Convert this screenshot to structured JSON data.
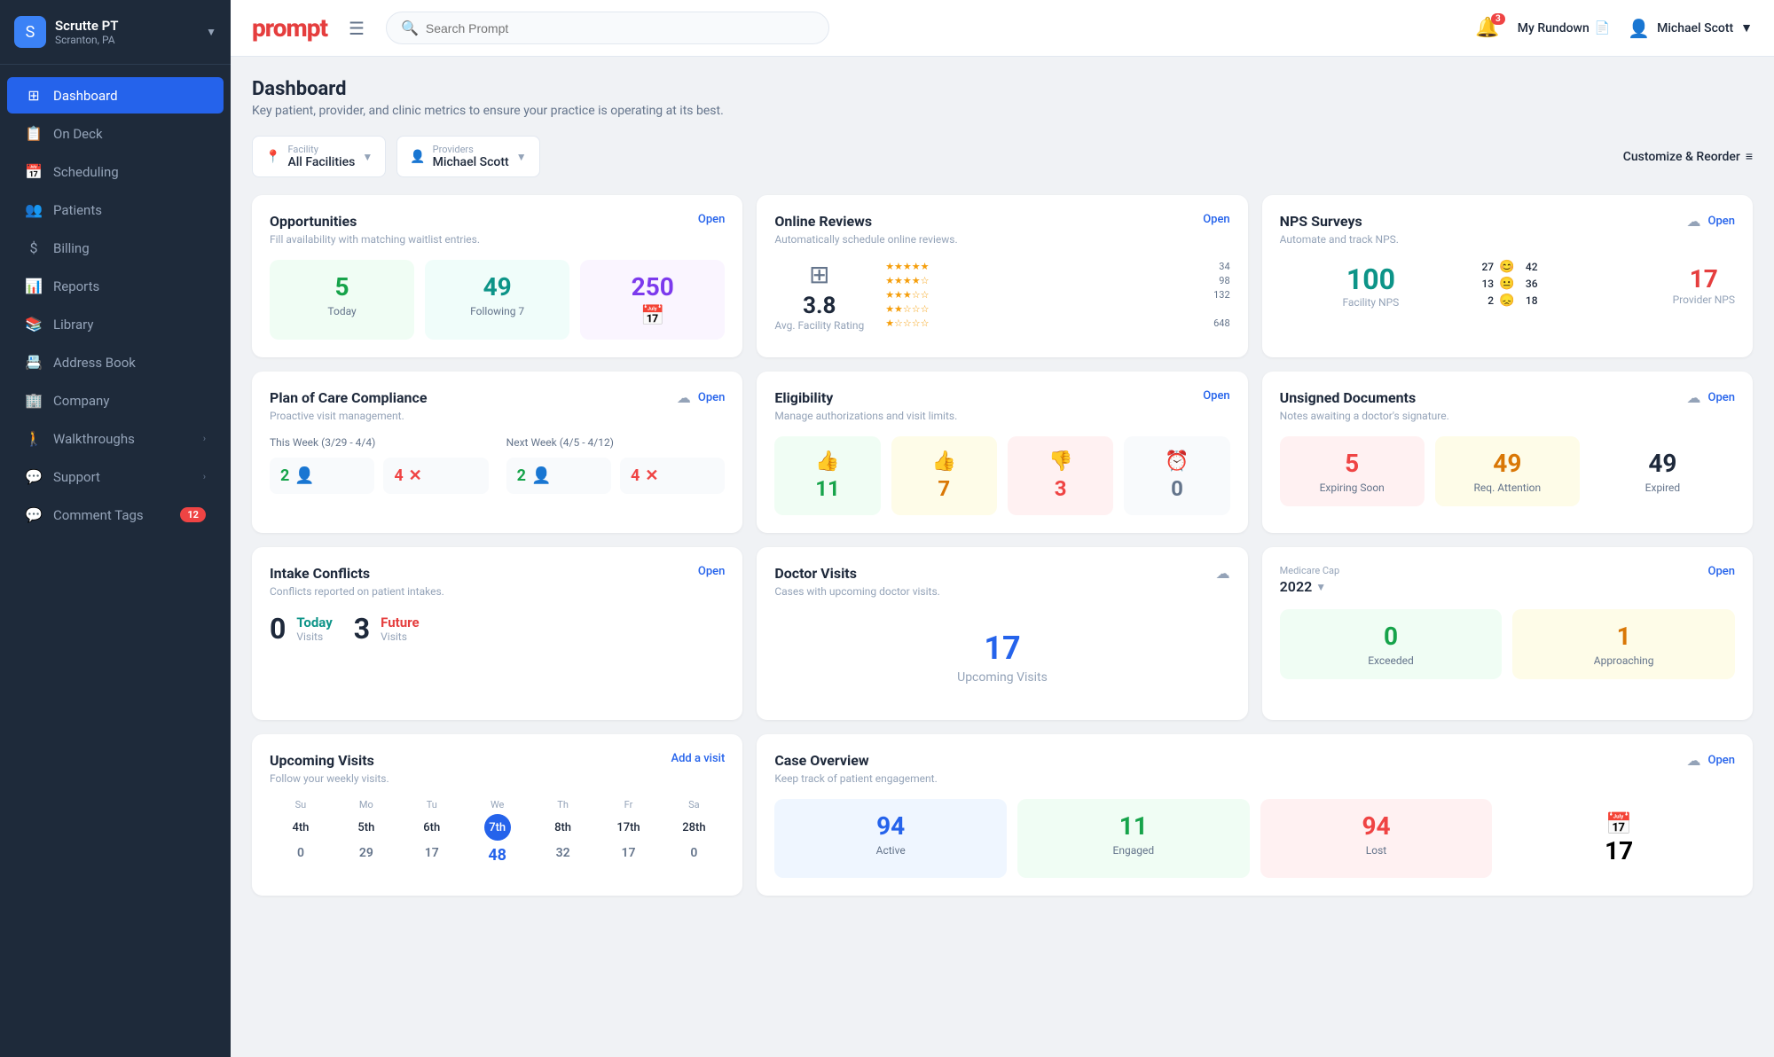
{
  "app": {
    "logo": "prompt",
    "search_placeholder": "Search Prompt"
  },
  "header": {
    "notification_count": "3",
    "my_rundown": "My Rundown",
    "user_name": "Michael Scott"
  },
  "sidebar": {
    "org_name": "Scrutte PT",
    "org_location": "Scranton, PA",
    "items": [
      {
        "id": "dashboard",
        "label": "Dashboard",
        "icon": "⊞",
        "active": true
      },
      {
        "id": "on-deck",
        "label": "On Deck",
        "icon": "📋",
        "active": false
      },
      {
        "id": "scheduling",
        "label": "Scheduling",
        "icon": "📅",
        "active": false
      },
      {
        "id": "patients",
        "label": "Patients",
        "icon": "👥",
        "active": false
      },
      {
        "id": "billing",
        "label": "Billing",
        "icon": "$",
        "active": false
      },
      {
        "id": "reports",
        "label": "Reports",
        "icon": "📊",
        "active": false
      },
      {
        "id": "library",
        "label": "Library",
        "icon": "📚",
        "active": false
      },
      {
        "id": "address-book",
        "label": "Address Book",
        "icon": "📇",
        "active": false
      },
      {
        "id": "company",
        "label": "Company",
        "icon": "🏢",
        "active": false
      },
      {
        "id": "walkthroughs",
        "label": "Walkthroughs",
        "icon": "🚶",
        "active": false,
        "arrow": true
      },
      {
        "id": "support",
        "label": "Support",
        "icon": "💬",
        "active": false,
        "arrow": true
      },
      {
        "id": "comment-tags",
        "label": "Comment Tags",
        "icon": "💬",
        "active": false,
        "badge": "12"
      }
    ]
  },
  "page": {
    "title": "Dashboard",
    "subtitle": "Key patient, provider, and clinic metrics to ensure your practice is operating at its best."
  },
  "filters": {
    "facility_label": "Facility",
    "facility_value": "All Facilities",
    "providers_label": "Providers",
    "providers_value": "Michael Scott",
    "customize_label": "Customize & Reorder"
  },
  "cards": {
    "opportunities": {
      "title": "Opportunities",
      "subtitle": "Fill availability with matching waitlist entries.",
      "open_label": "Open",
      "metrics": [
        {
          "value": "5",
          "label": "Today",
          "color": "green"
        },
        {
          "value": "49",
          "label": "Following 7",
          "color": "teal"
        },
        {
          "value": "250",
          "label": "",
          "color": "purple",
          "icon": "📅"
        }
      ]
    },
    "online_reviews": {
      "title": "Online Reviews",
      "subtitle": "Automatically schedule online reviews.",
      "open_label": "Open",
      "avg_rating": "3.8",
      "avg_label": "Avg. Facility Rating",
      "stars": [
        {
          "stars": 5,
          "count": "34"
        },
        {
          "stars": 4,
          "count": "98"
        },
        {
          "stars": 3,
          "count": "132"
        },
        {
          "stars": 2,
          "count": ""
        },
        {
          "stars": 1,
          "count": "648"
        }
      ]
    },
    "nps_surveys": {
      "title": "NPS Surveys",
      "subtitle": "Automate and track NPS.",
      "open_label": "Open",
      "facility_nps": "100",
      "facility_label": "Facility NPS",
      "rows": [
        {
          "left": "27",
          "face": "happy",
          "right": "42"
        },
        {
          "left": "13",
          "face": "neutral",
          "right": "36"
        },
        {
          "left": "2",
          "face": "sad",
          "right": "18"
        }
      ],
      "provider_nps": "17",
      "provider_label": "Provider NPS"
    },
    "plan_of_care": {
      "title": "Plan of Care Compliance",
      "subtitle": "Proactive visit management.",
      "open_label": "Open",
      "week1_label": "This Week (3/29 - 4/4)",
      "week1_metrics": [
        {
          "value": "2",
          "icon": "👤",
          "color": "green"
        },
        {
          "value": "4",
          "icon": "✕",
          "color": "red"
        }
      ],
      "week2_label": "Next Week (4/5 - 4/12)",
      "week2_metrics": [
        {
          "value": "2",
          "icon": "👤",
          "color": "green"
        },
        {
          "value": "4",
          "icon": "✕",
          "color": "red"
        }
      ]
    },
    "eligibility": {
      "title": "Eligibility",
      "subtitle": "Manage authorizations and visit limits.",
      "open_label": "Open",
      "metrics": [
        {
          "value": "11",
          "icon": "👍",
          "color": "green"
        },
        {
          "value": "7",
          "icon": "👍",
          "color": "yellow"
        },
        {
          "value": "3",
          "icon": "👎",
          "color": "red"
        },
        {
          "value": "0",
          "icon": "⏰",
          "color": "gray"
        }
      ]
    },
    "unsigned_docs": {
      "title": "Unsigned Documents",
      "subtitle": "Notes awaiting a doctor's signature.",
      "open_label": "Open",
      "metrics": [
        {
          "value": "5",
          "label": "Expiring Soon",
          "color": "red"
        },
        {
          "value": "49",
          "label": "Req. Attention",
          "color": "yellow"
        },
        {
          "value": "49",
          "label": "Expired",
          "color": "plain"
        }
      ]
    },
    "intake_conflicts": {
      "title": "Intake Conflicts",
      "subtitle": "Conflicts reported on patient intakes.",
      "open_label": "Open",
      "today_count": "0",
      "today_label": "Today",
      "today_sub": "Visits",
      "future_count": "3",
      "future_label": "Future",
      "future_sub": "Visits"
    },
    "doctor_visits": {
      "title": "Doctor Visits",
      "subtitle": "Cases with upcoming doctor visits.",
      "value": "17",
      "label": "Upcoming Visits"
    },
    "medicare_cap": {
      "title": "Medicare Cap",
      "year": "2022",
      "open_label": "Open",
      "metrics": [
        {
          "value": "0",
          "label": "Exceeded",
          "color": "green"
        },
        {
          "value": "1",
          "label": "Approaching",
          "color": "yellow"
        }
      ]
    },
    "upcoming_visits": {
      "title": "Upcoming Visits",
      "subtitle": "Follow your weekly visits.",
      "add_visit_label": "Add a visit",
      "days": [
        {
          "name": "Su",
          "num": "4th",
          "count": "0"
        },
        {
          "name": "Mo",
          "num": "5th",
          "count": "29"
        },
        {
          "name": "Tu",
          "num": "6th",
          "count": "17"
        },
        {
          "name": "We",
          "num": "7th",
          "count": "48",
          "active": true
        },
        {
          "name": "Th",
          "num": "8th",
          "count": "32"
        },
        {
          "name": "Fr",
          "num": "17th",
          "count": "17"
        },
        {
          "name": "Sa",
          "num": "28th",
          "count": "0"
        }
      ]
    },
    "case_overview": {
      "title": "Case Overview",
      "subtitle": "Keep track of patient engagement.",
      "open_label": "Open",
      "metrics": [
        {
          "value": "94",
          "label": "Active",
          "color": "blue"
        },
        {
          "value": "11",
          "label": "Engaged",
          "color": "green"
        },
        {
          "value": "94",
          "label": "Lost",
          "color": "red"
        },
        {
          "value": "17",
          "label": "",
          "icon": "📅",
          "color": "plain"
        }
      ]
    }
  }
}
